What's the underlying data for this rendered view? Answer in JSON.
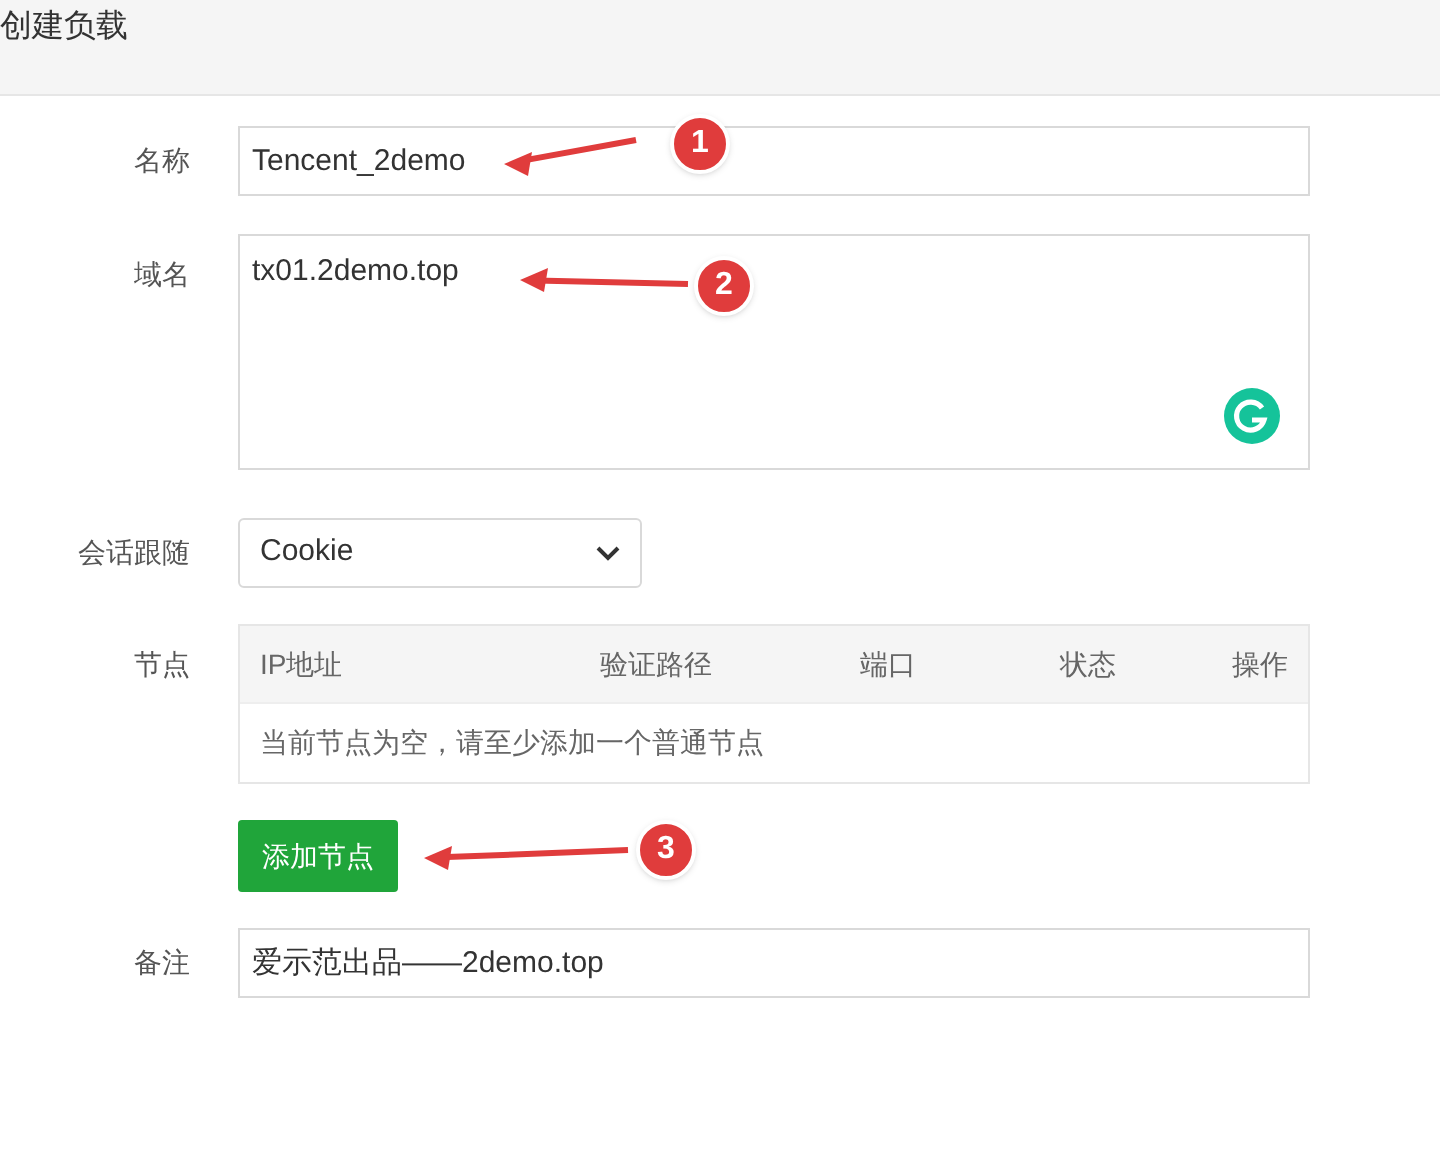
{
  "header": {
    "title": "创建负载"
  },
  "form": {
    "name": {
      "label": "名称",
      "value": "Tencent_2demo"
    },
    "domain": {
      "label": "域名",
      "value": "tx01.2demo.top"
    },
    "session": {
      "label": "会话跟随",
      "value": "Cookie"
    },
    "nodes": {
      "label": "节点",
      "columns": [
        "IP地址",
        "验证路径",
        "端口",
        "状态",
        "操作"
      ],
      "empty_text": "当前节点为空，请至少添加一个普通节点"
    },
    "add_button": "添加节点",
    "remark": {
      "label": "备注",
      "value": "爱示范出品——2demo.top"
    }
  },
  "annotations": [
    {
      "number": "1"
    },
    {
      "number": "2"
    },
    {
      "number": "3"
    }
  ]
}
